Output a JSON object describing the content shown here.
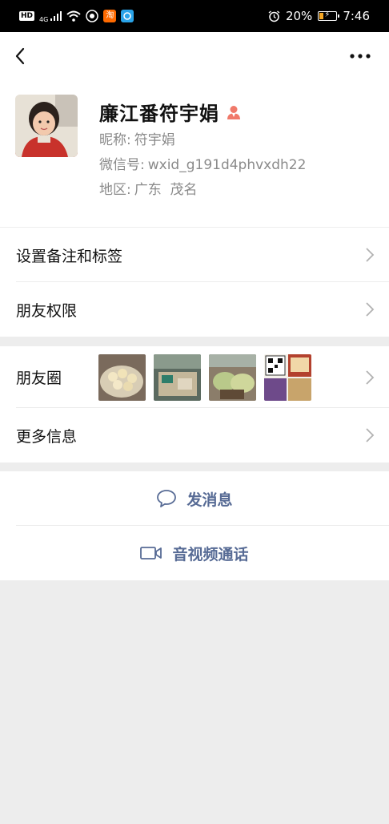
{
  "status_bar": {
    "hd": "HD",
    "network": "4G",
    "app_badge": "淘",
    "battery_pct": "20%",
    "battery_level": 0.2,
    "time": "7:46"
  },
  "navbar": {
    "back_icon": "chevron-left-icon",
    "more_icon": "more-dots-icon"
  },
  "profile": {
    "name": "廉江番符宇娟",
    "nickname_label": "昵称:",
    "nickname": "符宇娟",
    "wechat_id_label": "微信号:",
    "wechat_id": "wxid_g191d4phvxdh22",
    "region_label": "地区:",
    "region": "广东  茂名",
    "gender_icon": "female-person-icon",
    "accent_color": "#f0796a"
  },
  "settings": {
    "remark_tags": "设置备注和标签",
    "friend_permissions": "朋友权限"
  },
  "moments": {
    "label": "朋友圈",
    "thumbnails": [
      "food-photo-1",
      "market-photo",
      "fruit-stall-photo",
      "qr-poster-photo"
    ]
  },
  "more_info": {
    "label": "更多信息"
  },
  "actions": {
    "send_message": "发消息",
    "av_call": "音视频通话",
    "link_color": "#576b95"
  }
}
